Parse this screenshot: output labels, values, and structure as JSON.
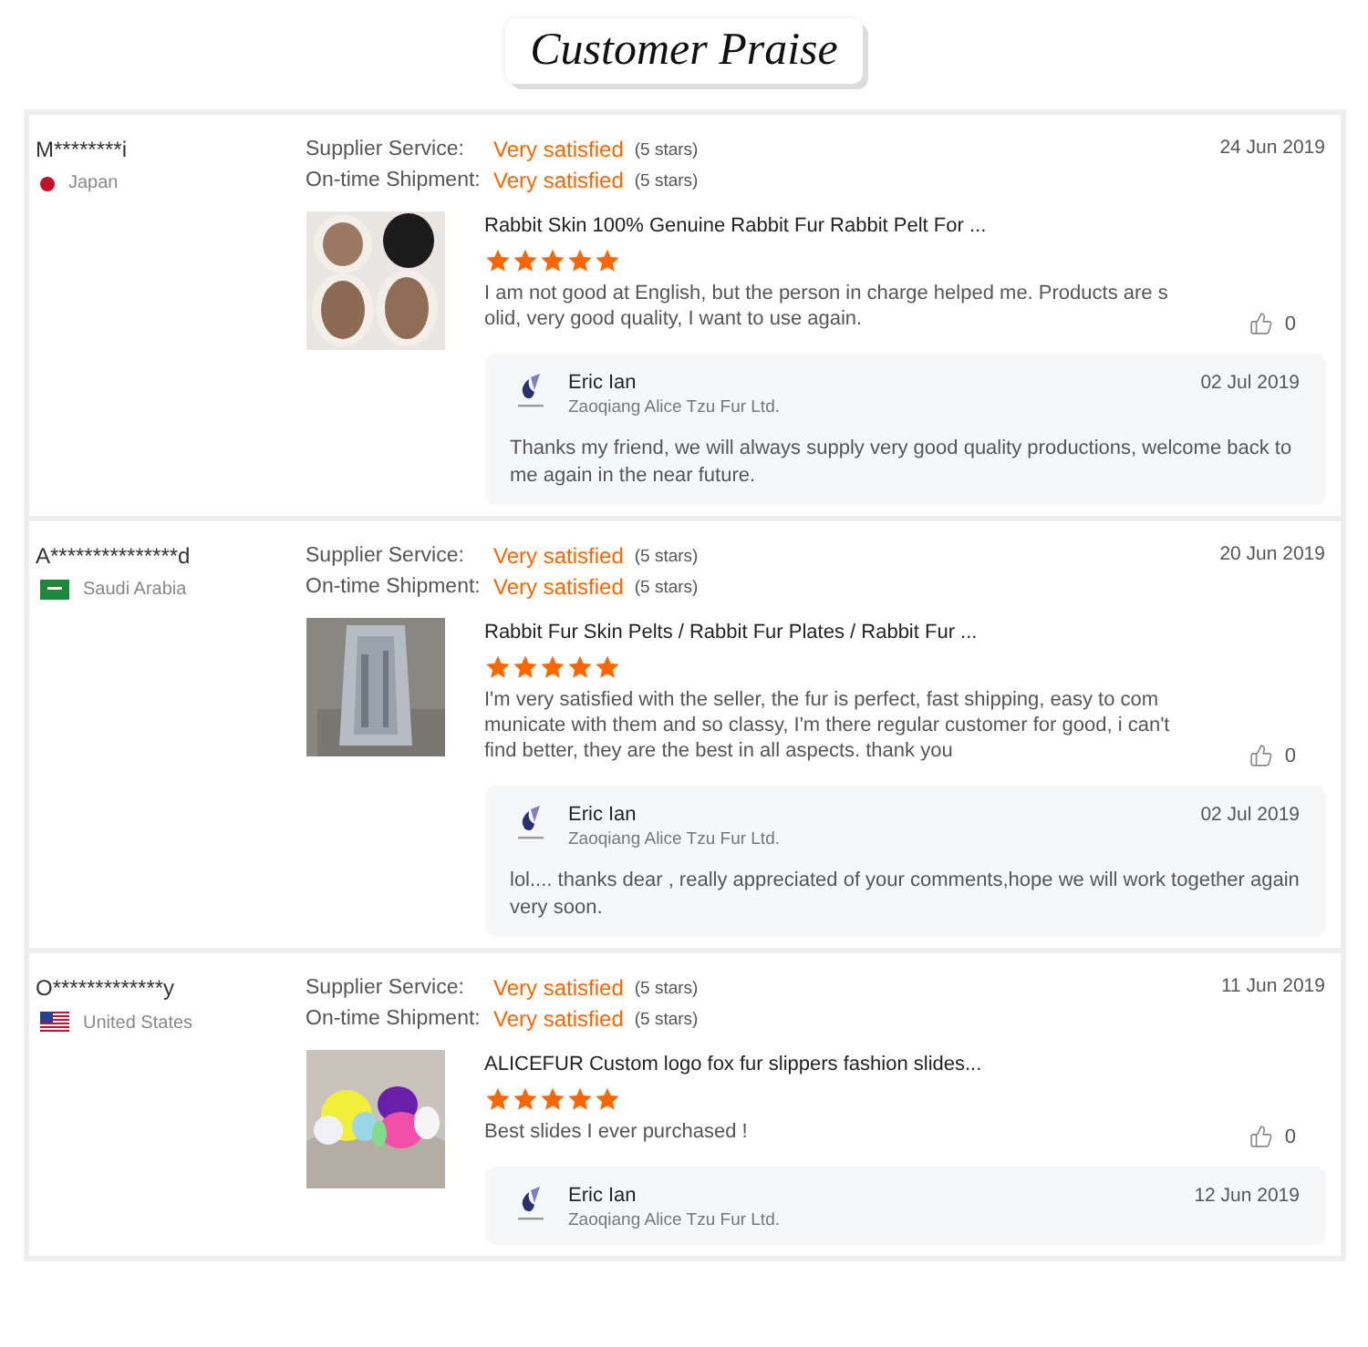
{
  "header": {
    "title": "Customer Praise"
  },
  "reviews": [
    {
      "buyer": "M********i",
      "country": "Japan",
      "date": "24 Jun 2019",
      "ratings": [
        {
          "label": "Supplier Service:",
          "value": "Very satisfied",
          "note": "(5 stars)"
        },
        {
          "label": "On-time Shipment:",
          "value": "Very satisfied",
          "note": "(5 stars)"
        }
      ],
      "product": {
        "title": "Rabbit Skin 100% Genuine Rabbit Fur Rabbit Pelt For ...",
        "kind": "picture"
      },
      "stars": 5,
      "comment": "I am not good at English, but the person in charge helped me. Products are solid, very good quality, I want to use again.",
      "likes": "0",
      "reply": {
        "name": "Eric Ian",
        "company": "Zaoqiang Alice Tzu Fur Ltd.",
        "date": "02 Jul 2019",
        "text": "Thanks my friend, we will always supply very good quality productions, welcome back to me again in the near future."
      }
    },
    {
      "buyer": "A***************d",
      "country": "Saudi Arabia",
      "date": "20 Jun 2019",
      "ratings": [
        {
          "label": "Supplier Service:",
          "value": "Very satisfied",
          "note": "(5 stars)"
        },
        {
          "label": "On-time Shipment:",
          "value": "Very satisfied",
          "note": "(5 stars)"
        }
      ],
      "product": {
        "title": "Rabbit Fur Skin Pelts / Rabbit Fur Plates / Rabbit Fur ...",
        "kind": "picture"
      },
      "stars": 5,
      "comment": "I'm very satisfied with the seller,  the fur is perfect, fast shipping, easy to communicate with them and so classy, I'm there regular customer for good, i can't find better, they are the best in all aspects. thank you",
      "likes": "0",
      "reply": {
        "name": "Eric Ian",
        "company": "Zaoqiang Alice Tzu Fur Ltd.",
        "date": "02 Jul 2019",
        "text": "lol.... thanks dear , really appreciated of your comments,hope we will work together again very soon."
      }
    },
    {
      "buyer": "O*************y",
      "country": "United States",
      "date": "11 Jun 2019",
      "ratings": [
        {
          "label": "Supplier Service:",
          "value": "Very satisfied",
          "note": "(5 stars)"
        },
        {
          "label": "On-time Shipment:",
          "value": "Very satisfied",
          "note": "(5 stars)"
        }
      ],
      "product": {
        "title": "ALICEFUR Custom logo fox fur slippers fashion slides...",
        "kind": "picture"
      },
      "stars": 5,
      "comment": "Best slides I ever purchased !",
      "likes": "0",
      "reply": {
        "name": "Eric Ian",
        "company": "Zaoqiang Alice Tzu Fur Ltd.",
        "date": "12 Jun 2019"
      }
    }
  ]
}
